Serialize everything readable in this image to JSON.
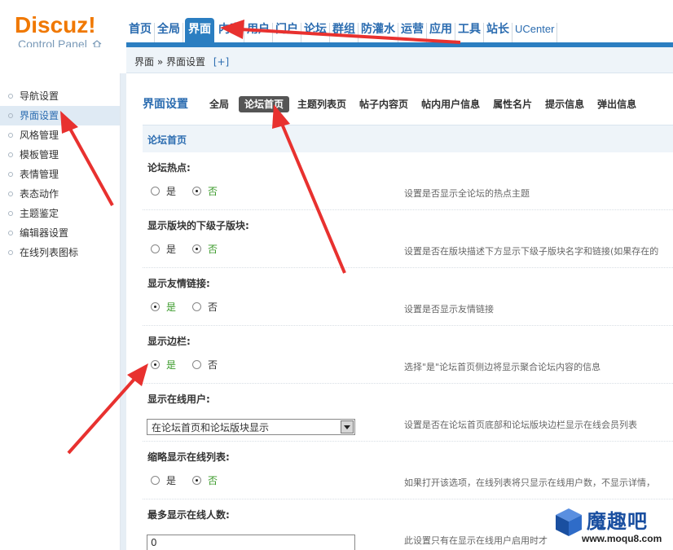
{
  "logo": {
    "title": "Discuz!",
    "subtitle": "Control Panel"
  },
  "nav": [
    {
      "label": "首页"
    },
    {
      "label": "全局"
    },
    {
      "label": "界面",
      "active": true
    },
    {
      "label": "内容"
    },
    {
      "label": "用户"
    },
    {
      "label": "门户"
    },
    {
      "label": "论坛"
    },
    {
      "label": "群组"
    },
    {
      "label": "防灌水"
    },
    {
      "label": "运营"
    },
    {
      "label": "应用"
    },
    {
      "label": "工具"
    },
    {
      "label": "站长"
    },
    {
      "label": "UCenter"
    }
  ],
  "breadcrumb": {
    "text": "界面 » 界面设置",
    "add": "[+]"
  },
  "sidebar": {
    "items": [
      {
        "label": "导航设置"
      },
      {
        "label": "界面设置",
        "active": true
      },
      {
        "label": "风格管理"
      },
      {
        "label": "模板管理"
      },
      {
        "label": "表情管理"
      },
      {
        "label": "表态动作"
      },
      {
        "label": "主题鉴定"
      },
      {
        "label": "编辑器设置"
      },
      {
        "label": "在线列表图标"
      }
    ]
  },
  "tabs": {
    "title": "界面设置",
    "items": [
      {
        "label": "全局"
      },
      {
        "label": "论坛首页",
        "active": true
      },
      {
        "label": "主题列表页"
      },
      {
        "label": "帖子内容页"
      },
      {
        "label": "帖内用户信息"
      },
      {
        "label": "属性名片"
      },
      {
        "label": "提示信息"
      },
      {
        "label": "弹出信息"
      }
    ]
  },
  "section": {
    "title": "论坛首页"
  },
  "settings": [
    {
      "title": "论坛热点:",
      "yes": "是",
      "no": "否",
      "value": "no",
      "desc": "设置是否显示全论坛的热点主题"
    },
    {
      "title": "显示版块的下级子版块:",
      "yes": "是",
      "no": "否",
      "value": "no",
      "desc": "设置是否在版块描述下方显示下级子版块名字和链接(如果存在的"
    },
    {
      "title": "显示友情链接:",
      "yes": "是",
      "no": "否",
      "value": "yes",
      "desc": "设置是否显示友情链接"
    },
    {
      "title": "显示边栏:",
      "yes": "是",
      "no": "否",
      "value": "yes",
      "desc": "选择\"是\"论坛首页侧边将显示聚合论坛内容的信息"
    },
    {
      "title": "显示在线用户:",
      "select_value": "在论坛首页和论坛版块显示",
      "desc": "设置是否在论坛首页底部和论坛版块边栏显示在线会员列表"
    },
    {
      "title": "缩略显示在线列表:",
      "yes": "是",
      "no": "否",
      "value": "no",
      "desc": "如果打开该选项，在线列表将只显示在线用户数，不显示详情，"
    },
    {
      "title": "最多显示在线人数:",
      "input_value": "0",
      "desc": "此设置只有在显示在线用户启用时才"
    }
  ],
  "watermark": {
    "brand": "魔趣吧",
    "url": "www.moqu8.com"
  },
  "colors": {
    "accent": "#2b7ec1",
    "logo": "#f07800",
    "arrow": "#e8312f",
    "checked_label": "#3a9a2a"
  }
}
